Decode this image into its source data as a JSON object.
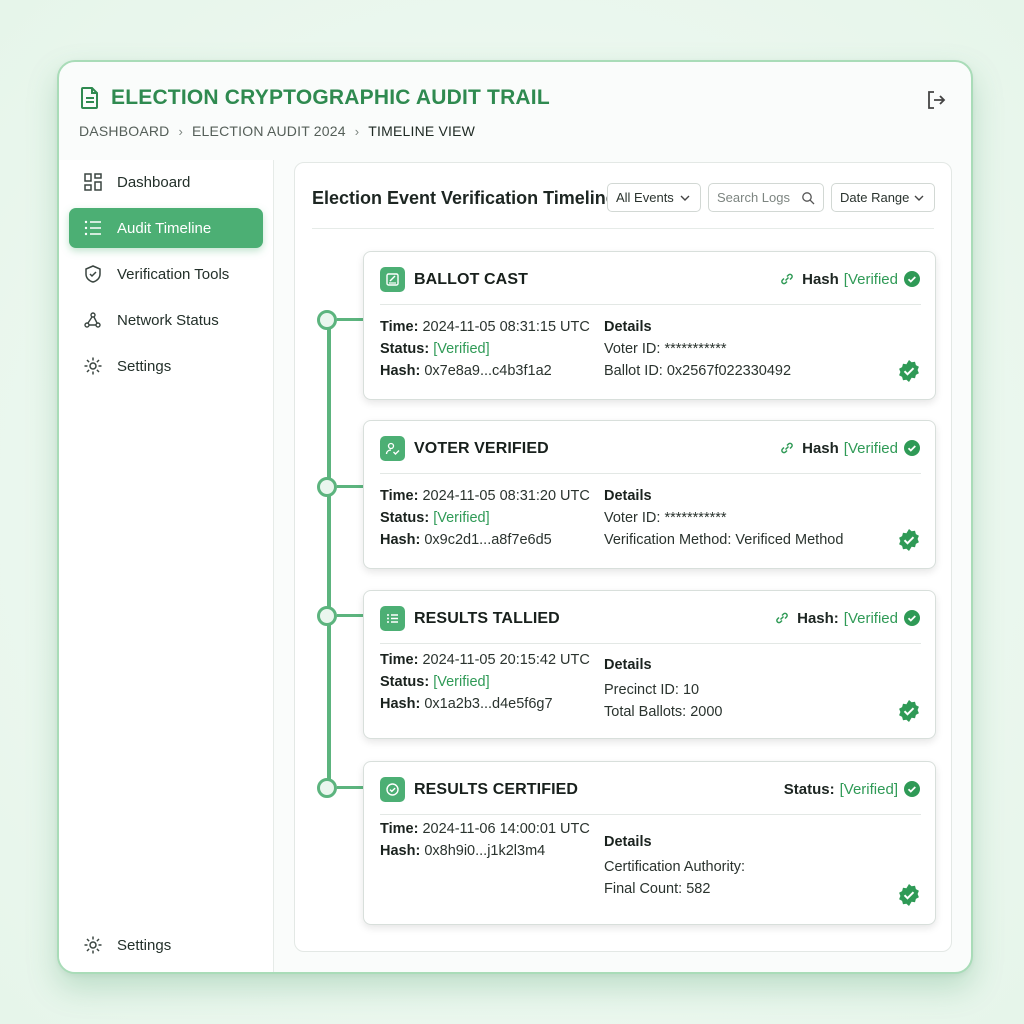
{
  "app": {
    "title": "ELECTION CRYPTOGRAPHIC AUDIT TRAIL",
    "breadcrumb": [
      "DASHBOARD",
      "ELECTION AUDIT 2024",
      "TIMELINE VIEW"
    ]
  },
  "sidebar": {
    "items": [
      {
        "label": "Dashboard",
        "icon": "grid-icon"
      },
      {
        "label": "Audit Timeline",
        "icon": "list-icon",
        "active": true
      },
      {
        "label": "Verification Tools",
        "icon": "shield-check-icon"
      },
      {
        "label": "Network Status",
        "icon": "network-icon"
      },
      {
        "label": "Settings",
        "icon": "gear-icon"
      }
    ],
    "footer": {
      "label": "Settings",
      "icon": "gear-icon"
    }
  },
  "main": {
    "title": "Election Event Verification Timeline",
    "filter": {
      "selected": "All Events"
    },
    "search": {
      "placeholder": "Search Logs"
    },
    "date_range": {
      "label": "Date Range"
    }
  },
  "events": [
    {
      "title": "BALLOT CAST",
      "icon": "ballot-icon",
      "badge_label": "Hash",
      "badge_value": "[Verified",
      "time_label": "Time:",
      "time": "2024-11-05 08:31:15 UTC",
      "status_label": "Status:",
      "status": "[Verified]",
      "hash_label": "Hash:",
      "hash": "0x7e8a9...c4b3f1a2",
      "details_label": "Details",
      "details": [
        "Voter ID: ***********",
        "Ballot ID: 0x2567f022330492"
      ]
    },
    {
      "title": "VOTER VERIFIED",
      "icon": "user-check-icon",
      "badge_label": "Hash",
      "badge_value": "[Verified",
      "time_label": "Time:",
      "time": "2024-11-05 08:31:20 UTC",
      "status_label": "Status:",
      "status": "[Verified]",
      "hash_label": "Hash:",
      "hash": "0x9c2d1...a8f7e6d5",
      "details_label": "Details",
      "details": [
        "Voter ID: ***********",
        "Verification Method: Verificed Method"
      ]
    },
    {
      "title": "RESULTS TALLIED",
      "icon": "list-icon",
      "badge_label": "Hash:",
      "badge_value": "[Verified",
      "time_label": "Time:",
      "time": "2024-11-05 20:15:42 UTC",
      "status_label": "Status:",
      "status": "[Verified]",
      "hash_label": "Hash:",
      "hash": "0x1a2b3...d4e5f6g7",
      "details_label": "Details",
      "details": [
        "Precinct ID: 10",
        "Total Ballots: 2000"
      ]
    },
    {
      "title": "RESULTS CERTIFIED",
      "icon": "check-circle-icon",
      "badge_label": "Status:",
      "badge_value": "[Verified]",
      "time_label": "Time:",
      "time": "2024-11-06 14:00:01 UTC",
      "hash_label": "Hash:",
      "hash": "0x8h9i0...j1k2l3m4",
      "details_label": "Details",
      "details": [
        "Certification Authority:",
        "Final Count: 582"
      ]
    }
  ],
  "colors": {
    "accent": "#4caf74",
    "verified": "#2f9a56",
    "title": "#2f8a50"
  }
}
